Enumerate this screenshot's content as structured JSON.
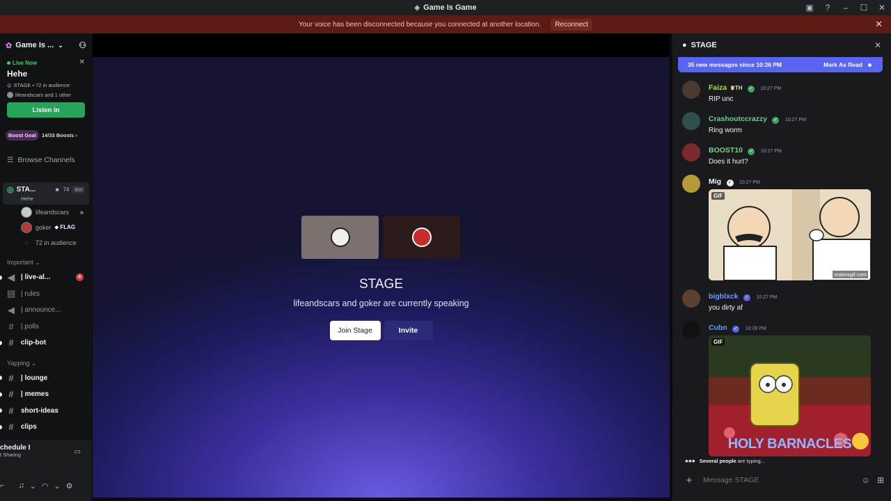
{
  "window": {
    "title": "Game Is Game"
  },
  "banner": {
    "message": "Your voice has been disconnected because you connected at another location.",
    "action": "Reconnect"
  },
  "server": {
    "name": "Game Is ...",
    "live": {
      "badge": "Live Now",
      "title": "Hehe",
      "info": "STAGE • 72 in audience",
      "speakers": "lifeandscars and 1 other",
      "button": "Listen In"
    },
    "boost": {
      "goal": "Boost Goal",
      "progress": "14/33 Boosts"
    },
    "browse": "Browse Channels",
    "stage_channel": {
      "name": "STA...",
      "count": "74",
      "cap": "300",
      "topic": "Hehe"
    },
    "members": [
      {
        "name": "lifeandscars"
      },
      {
        "name": "goker",
        "tag": "FLAG"
      },
      {
        "name": "72 in audience"
      }
    ],
    "categories": [
      {
        "name": "Important",
        "channels": [
          {
            "name": "| live-al...",
            "badge": "8"
          },
          {
            "name": "| rules"
          },
          {
            "name": "| announce..."
          },
          {
            "name": "| polls"
          },
          {
            "name": "clip-bot"
          }
        ]
      },
      {
        "name": "Yapping",
        "channels": [
          {
            "name": "| lounge"
          },
          {
            "name": "| memes"
          },
          {
            "name": "short-ideas"
          },
          {
            "name": "clips"
          }
        ]
      }
    ]
  },
  "activity": {
    "title": "chedule I",
    "subtitle": "t Sharing"
  },
  "stage": {
    "title": "STAGE",
    "subtitle": "lifeandscars and goker are currently speaking",
    "join_button": "Join Stage",
    "invite_button": "Invite"
  },
  "chat": {
    "title": "STAGE",
    "new_messages": "35 new messages since 10:26 PM",
    "mark_read": "Mark As Read",
    "messages": [
      {
        "author": "Faiza",
        "tag": "TH",
        "time": "10:27 PM",
        "text": "RIP unc",
        "color": "#a6e22e"
      },
      {
        "author": "Crashoutccrazzy",
        "time": "10:27 PM",
        "text": "Ring worm",
        "color": "#57d68d"
      },
      {
        "author": "BOOST10",
        "time": "10:27 PM",
        "text": "Does it hurt?",
        "color": "#7fd18b"
      },
      {
        "author": "Mig",
        "time": "10:27 PM",
        "gif_label": "GIF",
        "gif_watermark": "makeagif.com",
        "color": "#f2f3f5"
      },
      {
        "author": "bigblxck",
        "time": "10:27 PM",
        "text": "you dirty af",
        "color": "#6a9cff"
      },
      {
        "author": "Cubn",
        "time": "10:28 PM",
        "gif_label": "GIF",
        "gif_caption": "HOLY BARNACLES",
        "color": "#4da3ff"
      }
    ],
    "typing": {
      "who": "Several people",
      "rest": "are typing..."
    },
    "composer_placeholder": "Message STAGE"
  }
}
